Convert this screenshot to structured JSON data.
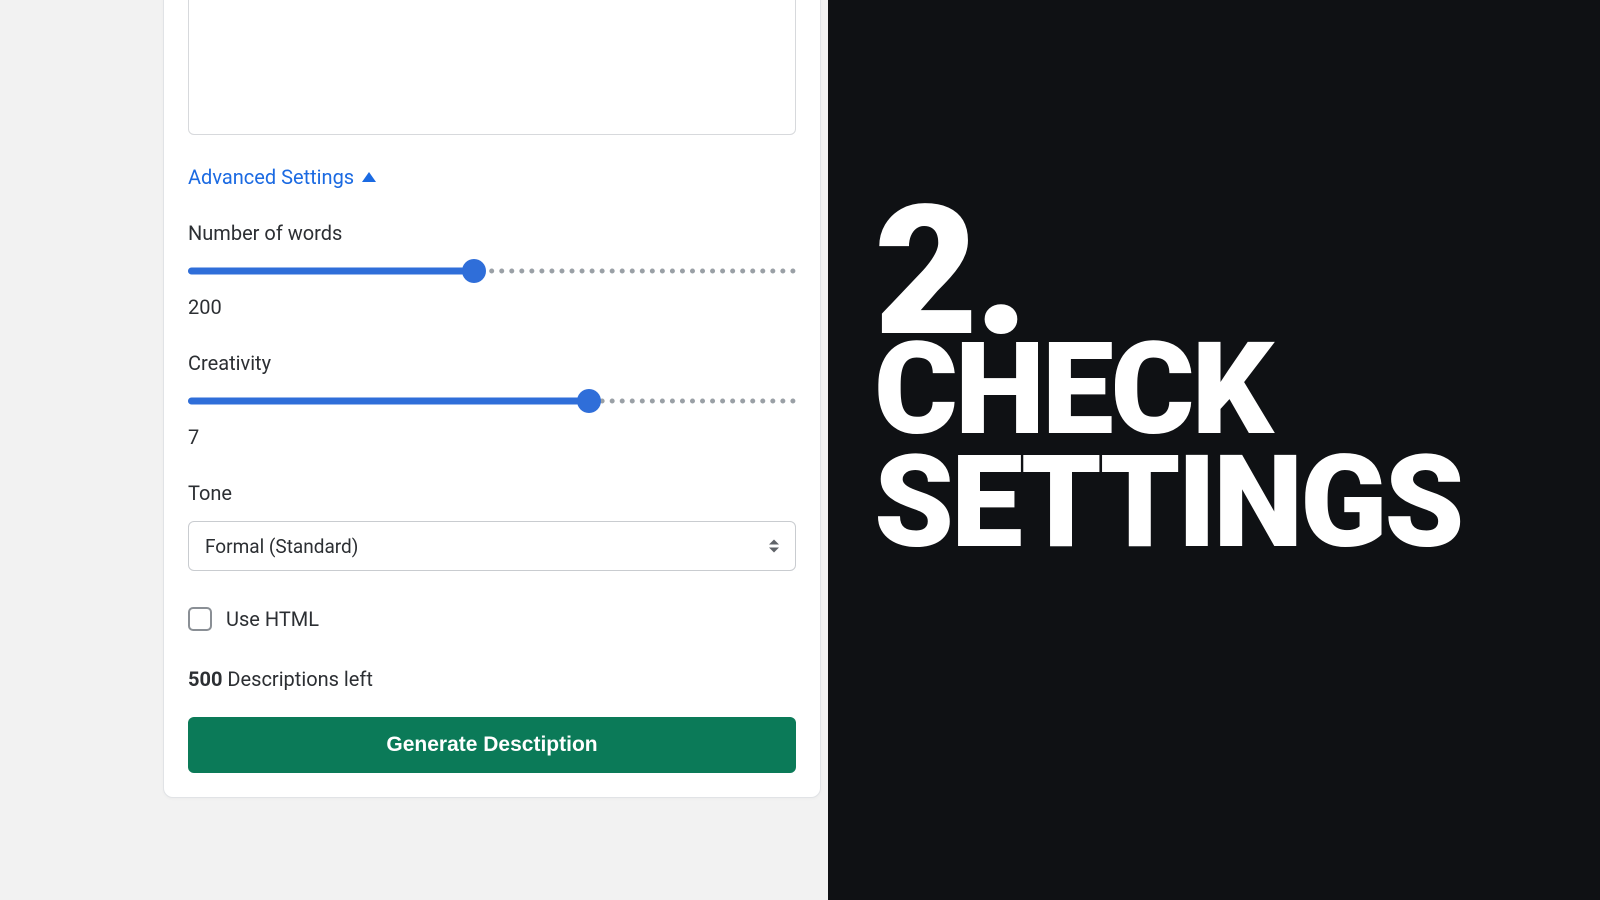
{
  "card": {
    "advanced_toggle": "Advanced Settings",
    "word_count": {
      "label": "Number of words",
      "value": "200",
      "fill_percent": 47
    },
    "creativity": {
      "label": "Creativity",
      "value": "7",
      "fill_percent": 66
    },
    "tone": {
      "label": "Tone",
      "selected": "Formal (Standard)"
    },
    "use_html": {
      "label": "Use HTML",
      "checked": false
    },
    "descriptions_left": {
      "count": "500",
      "suffix": " Descriptions left"
    },
    "generate_button": "Generate Desctiption"
  },
  "step": {
    "number": "2.",
    "line1": "CHECK",
    "line2": "SETTINGS"
  }
}
